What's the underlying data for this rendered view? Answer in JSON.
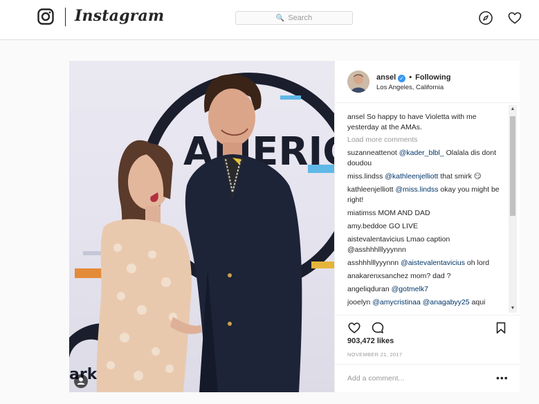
{
  "nav": {
    "logo_text": "Instagram",
    "search_placeholder": "Search"
  },
  "post": {
    "username": "ansel",
    "follow_status": "Following",
    "location": "Los Angeles, California",
    "caption_user": "ansel",
    "caption_text": " So happy to have Violetta with me yesterday at the AMAs.",
    "load_more": "Load more comments",
    "comments": [
      {
        "user": "suzanneattenot",
        "mention": "@kader_blbl_",
        "text": " Olalala dis dont doudou"
      },
      {
        "user": "miss.lindss",
        "mention": "@kathleenjelliott",
        "text": " that smirk 😏"
      },
      {
        "user": "kathleenjelliott",
        "mention": "@miss.lindss",
        "text": " okay you might be right!"
      },
      {
        "user": "miatimss",
        "mention": "",
        "text": " MOM AND DAD"
      },
      {
        "user": "amy.beddoe",
        "mention": "",
        "text": " GO LIVE"
      },
      {
        "user": "aistevalentavicius",
        "mention": "",
        "text": " Lmao caption @asshhhlllyyynnn"
      },
      {
        "user": "asshhhlllyyynnn",
        "mention": "@aistevalentavicius",
        "text": " oh lord"
      },
      {
        "user": "anakarenxsanchez",
        "mention": "",
        "text": " mom? dad ?"
      },
      {
        "user": "angeliqduran",
        "mention": "@gotmelk7",
        "text": ""
      },
      {
        "user": "jooelyn",
        "mention": "@amycristinaa @anagabyy25",
        "text": " aqui"
      }
    ],
    "likes": "903,472 likes",
    "date": "NOVEMBER 21, 2017",
    "add_comment_placeholder": "Add a comment...",
    "more_options": "•••",
    "photo_text": "AMERIC"
  },
  "colors": {
    "link": "#003569",
    "verified": "#3897f0",
    "border": "#dbdbdb",
    "muted": "#999999"
  }
}
